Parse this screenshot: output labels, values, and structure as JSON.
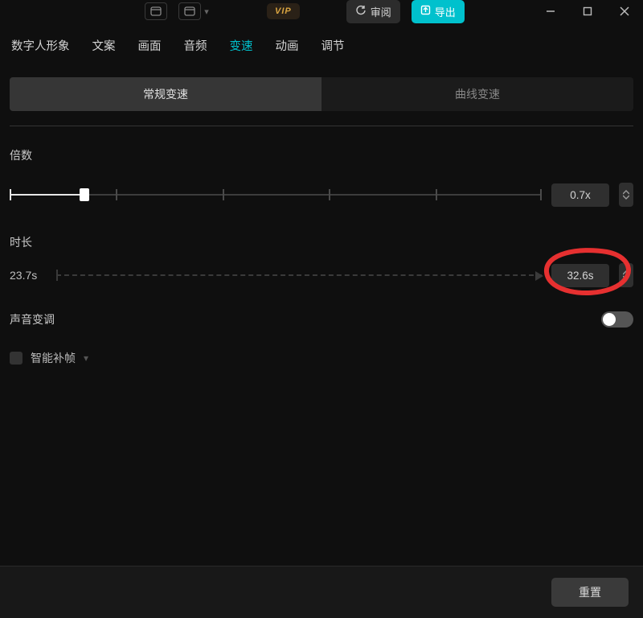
{
  "topbar": {
    "vip_label": "VIP",
    "review_label": "审阅",
    "export_label": "导出"
  },
  "tabs": [
    {
      "label": "数字人形象",
      "active": false
    },
    {
      "label": "文案",
      "active": false
    },
    {
      "label": "画面",
      "active": false
    },
    {
      "label": "音频",
      "active": false
    },
    {
      "label": "变速",
      "active": true
    },
    {
      "label": "动画",
      "active": false
    },
    {
      "label": "调节",
      "active": false
    }
  ],
  "segment": {
    "normal_label": "常规变速",
    "curve_label": "曲线变速",
    "active_index": 0
  },
  "multiplier": {
    "label": "倍数",
    "value_display": "0.7x",
    "value_numeric": 0.7,
    "thumb_percent": 14,
    "tick_percents": [
      0,
      20,
      40,
      60,
      80,
      100
    ]
  },
  "duration": {
    "label": "时长",
    "source_display": "23.7s",
    "target_display": "32.6s"
  },
  "pitch": {
    "label": "声音变调",
    "enabled": false
  },
  "smart_frame": {
    "label": "智能补帧",
    "checked": false
  },
  "footer": {
    "reset_label": "重置"
  },
  "annotation": {
    "present": true
  }
}
